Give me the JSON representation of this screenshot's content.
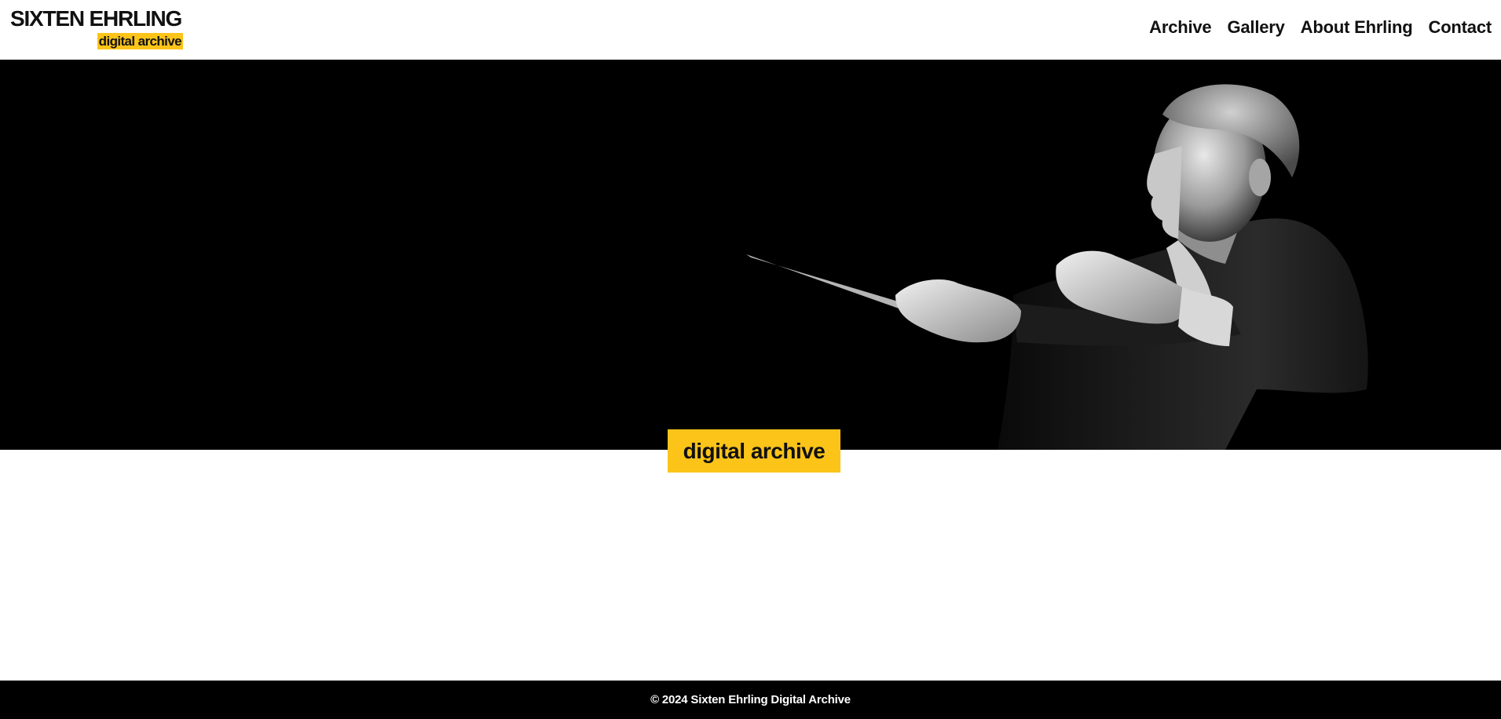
{
  "header": {
    "logo_title": "SIXTEN EHRLING",
    "logo_subtitle": "digital archive",
    "nav": [
      {
        "label": "Archive"
      },
      {
        "label": "Gallery"
      },
      {
        "label": "About Ehrling"
      },
      {
        "label": "Contact"
      }
    ]
  },
  "hero": {
    "image": "conductor-photo",
    "badge": "digital archive"
  },
  "footer": {
    "copyright": "© 2024 Sixten Ehrling Digital Archive"
  },
  "colors": {
    "accent": "#fcc419",
    "text": "#111111",
    "dark": "#000000"
  }
}
